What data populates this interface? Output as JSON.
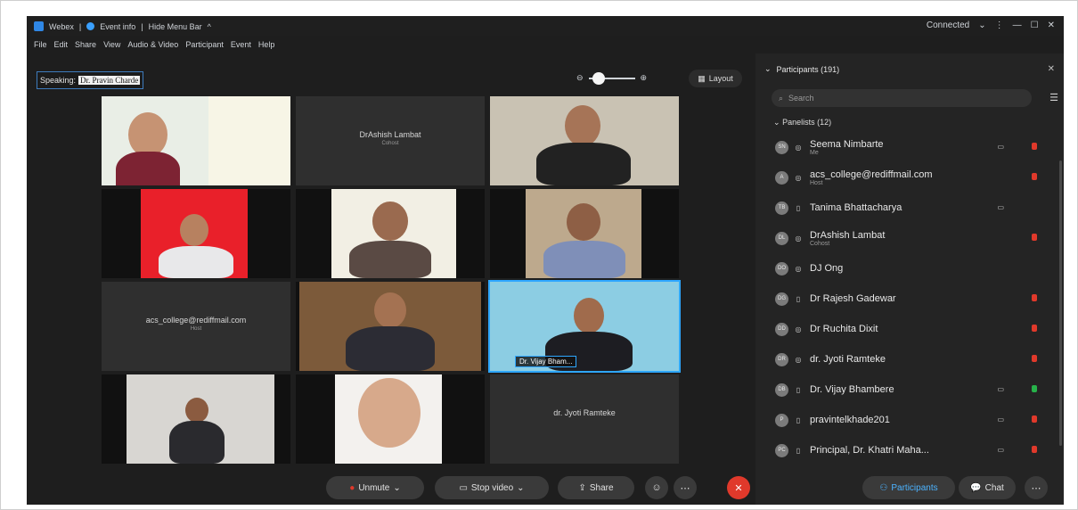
{
  "window": {
    "app_name": "Webex",
    "event_info": "Event info",
    "hide_menu": "Hide Menu Bar",
    "status": "Connected"
  },
  "menu": [
    "File",
    "Edit",
    "Share",
    "View",
    "Audio & Video",
    "Participant",
    "Event",
    "Help"
  ],
  "speaking": {
    "label": "Speaking:",
    "name": "Dr. Pravin Charde"
  },
  "toolbar": {
    "layout_label": "Layout"
  },
  "tiles": [
    {
      "name": "DrAshish Lambat",
      "role": "Cohost"
    },
    {
      "name": "acs_college@rediffmail.com",
      "role": "Host"
    },
    {
      "caption": "Dr. Vijay Bham..."
    },
    {
      "name": "dr. Jyoti Ramteke"
    }
  ],
  "participants_panel": {
    "title": "Participants (191)",
    "search_placeholder": "Search",
    "section_label": "Panelists (12)",
    "items": [
      {
        "initials": "SN",
        "name": "Seema Nimbarte",
        "role": "Me"
      },
      {
        "initials": "A",
        "name": "acs_college@rediffmail.com",
        "role": "Host"
      },
      {
        "initials": "TB",
        "name": "Tanima Bhattacharya",
        "role": ""
      },
      {
        "initials": "DL",
        "name": "DrAshish Lambat",
        "role": "Cohost"
      },
      {
        "initials": "DO",
        "name": "DJ Ong",
        "role": ""
      },
      {
        "initials": "DG",
        "name": "Dr Rajesh Gadewar",
        "role": ""
      },
      {
        "initials": "DD",
        "name": "Dr Ruchita Dixit",
        "role": ""
      },
      {
        "initials": "DR",
        "name": "dr. Jyoti Ramteke",
        "role": ""
      },
      {
        "initials": "DB",
        "name": "Dr. Vijay Bhambere",
        "role": ""
      },
      {
        "initials": "P",
        "name": "pravintelkhade201",
        "role": ""
      },
      {
        "initials": "PC",
        "name": "Principal, Dr. Khatri Maha...",
        "role": ""
      }
    ]
  },
  "controls": {
    "unmute": "Unmute",
    "stop_video": "Stop video",
    "share": "Share",
    "participants": "Participants",
    "chat": "Chat"
  },
  "colors": {
    "accent": "#2ea7ff",
    "leave": "#e0392b"
  }
}
